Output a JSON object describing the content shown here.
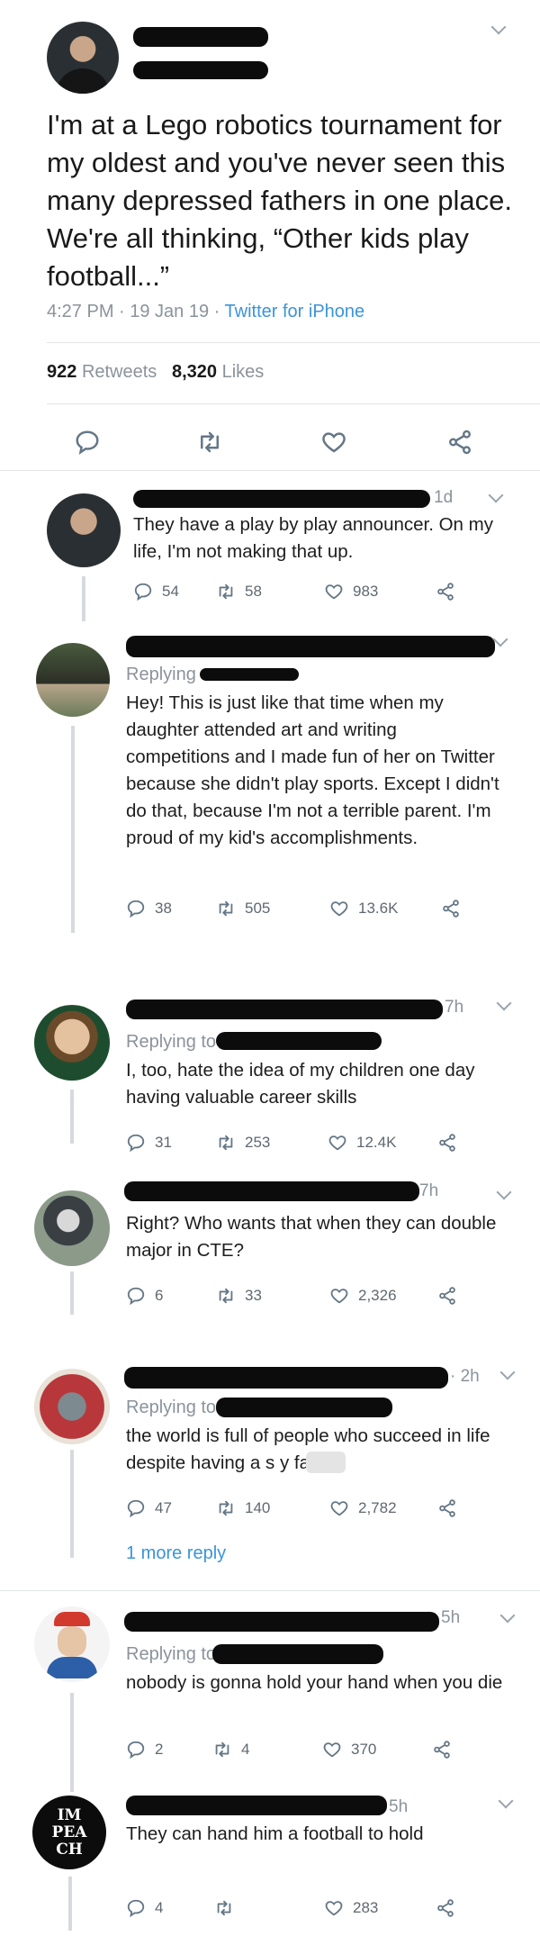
{
  "tweet": {
    "text": "I'm at a Lego robotics tournament for my oldest and you've never seen this many depressed fathers in one place. We're all thinking, “Other kids play football...”",
    "time": "4:27 PM · 19 Jan 19 · ",
    "client": "Twitter for iPhone",
    "retweets_count": "922",
    "retweets_label": "Retweets",
    "likes_count": "8,320",
    "likes_label": "Likes"
  },
  "replies": [
    {
      "time": "1d",
      "replying": "",
      "text": "They have a play by play announcer. On my life, I'm not making that up.",
      "reply_count": "54",
      "retweet_count": "58",
      "like_count": "983"
    },
    {
      "time": "",
      "replying": "Replying",
      "text": "Hey! This is just like that time when my daughter attended art and writing competitions and I made fun of her on Twitter because she didn't play sports. Except I didn't do that, because I'm not a terrible parent. I'm proud of my kid's accomplishments.",
      "reply_count": "38",
      "retweet_count": "505",
      "like_count": "13.6K"
    },
    {
      "time": "7h",
      "replying": "Replying to",
      "text": "I, too, hate the idea of my children one day having valuable career skills",
      "reply_count": "31",
      "retweet_count": "253",
      "like_count": "12.4K"
    },
    {
      "time": "7h",
      "replying": "",
      "text": "Right? Who wants that when they can double major in CTE?",
      "reply_count": "6",
      "retweet_count": "33",
      "like_count": "2,326"
    },
    {
      "time": "· 2h",
      "replying": "Replying to",
      "text": "the world is full of people who succeed in life despite having a s     y father",
      "reply_count": "47",
      "retweet_count": "140",
      "like_count": "2,782",
      "more_reply": "1 more reply"
    },
    {
      "time": "5h",
      "replying": "Replying to",
      "text": "nobody is gonna hold your hand when you die",
      "reply_count": "2",
      "retweet_count": "4",
      "like_count": "370"
    },
    {
      "time": "5h",
      "replying": "",
      "text": "They can hand him a football to hold",
      "reply_count": "4",
      "retweet_count": "",
      "like_count": "283",
      "avatar_text": "IM PEA CH"
    }
  ],
  "colors": {
    "accent_link": "#3b94d9",
    "muted": "#8a939b",
    "redaction": "#0c0c0c"
  }
}
